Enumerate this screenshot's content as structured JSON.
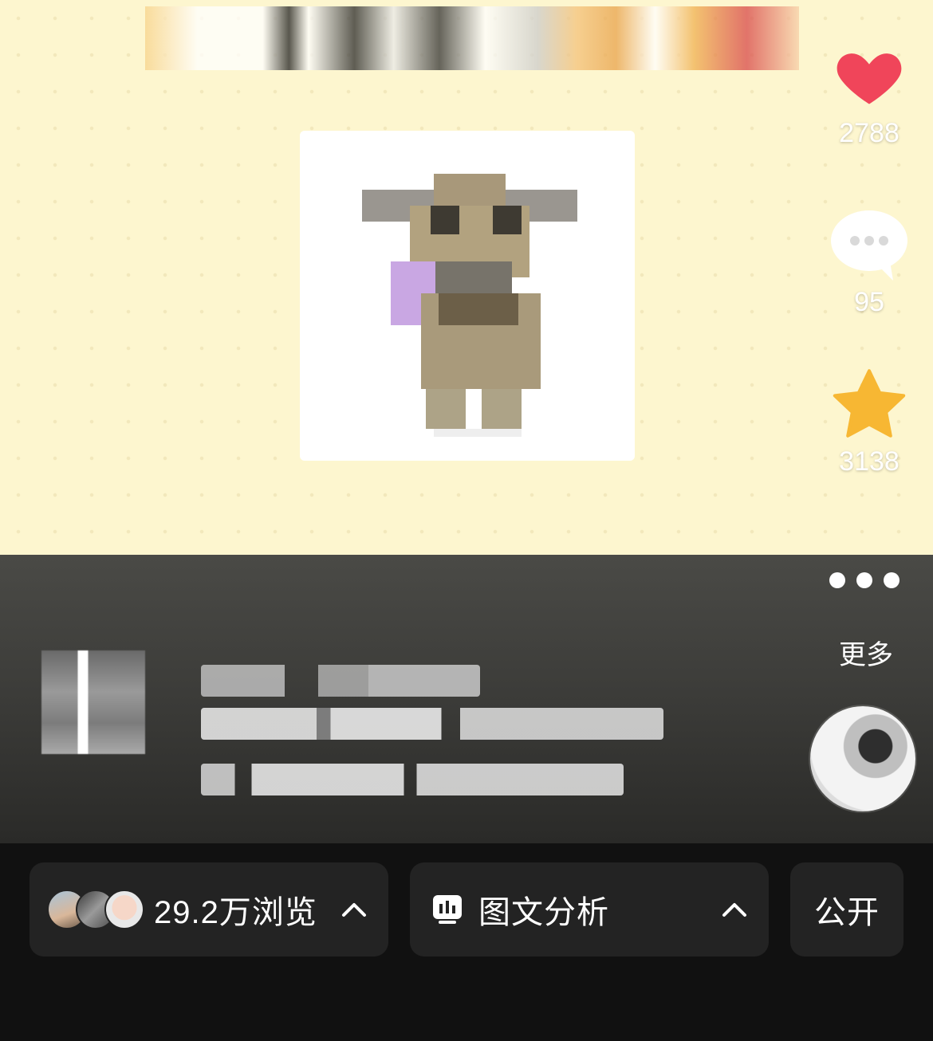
{
  "post": {
    "likes": "2788",
    "comments": "95",
    "favorites": "3138"
  },
  "info": {
    "more_label": "更多"
  },
  "bottom_bar": {
    "views_label": "29.2万浏览",
    "analysis_label": "图文分析",
    "visibility_label": "公开"
  },
  "colors": {
    "like": "#f0455a",
    "favorite": "#f7b733",
    "card_background": "#fdf6cf",
    "panel": "#3d3d3a",
    "bar": "#111111",
    "chip": "#232323"
  },
  "icons": {
    "like": "heart-icon",
    "comment": "comment-bubble-icon",
    "favorite": "star-icon",
    "more": "more-dots-icon",
    "analysis": "bar-chart-icon",
    "expand": "chevron-up-icon"
  }
}
